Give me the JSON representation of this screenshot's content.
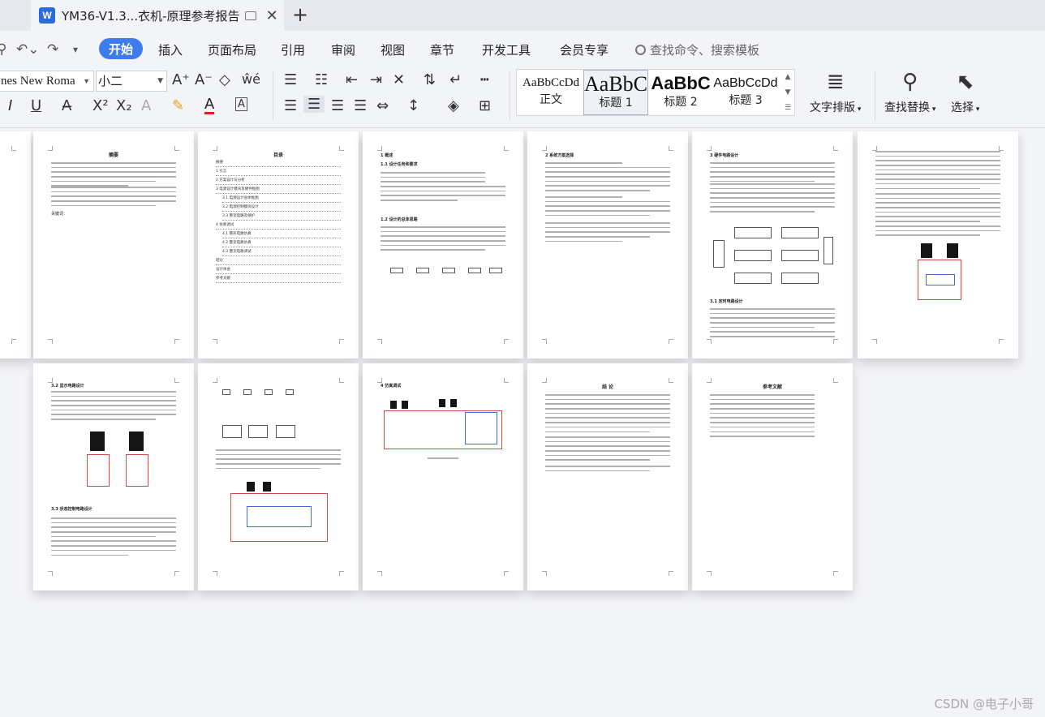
{
  "tab": {
    "icon_letter": "W",
    "title": "YM36-V1.3...衣机-原理参考报告",
    "new_tab": "+"
  },
  "menu": {
    "items": [
      "开始",
      "插入",
      "页面布局",
      "引用",
      "审阅",
      "视图",
      "章节",
      "开发工具",
      "会员专享"
    ],
    "search": "查找命令、搜索模板"
  },
  "ribbon": {
    "font_name": "nes New Roma",
    "font_size": "小二",
    "styles": [
      {
        "sample": "AaBbCcDd",
        "name": "正文"
      },
      {
        "sample": "AaBbC",
        "name": "标题 1"
      },
      {
        "sample": "AaBbC",
        "name": "标题 2"
      },
      {
        "sample": "AaBbCcDd",
        "name": "标题 3"
      }
    ],
    "text_layout": "文字排版",
    "find_replace": "查找替换",
    "select": "选择"
  },
  "pages": {
    "p1_title": "摘要",
    "p1_keywords": "关键词：",
    "p2_title": "目录",
    "toc": [
      "摘要",
      "1 引言",
      "2 方案设计与分析",
      "3 电源设计模块及硬件框图",
      "3.1 电源设计总体框图",
      "3.2 电源控制模块设计",
      "3.3 整流电路及保护",
      "4 仿真调试",
      "4.1 整形电路仿真",
      "4.2 整流电路仿真",
      "4.3 整流电路调试",
      "结论",
      "设计体会",
      "参考文献"
    ],
    "p3_h1": "1 概述",
    "p3_h2a": "1.1 设计任务和要求",
    "p3_h2b": "1.2 设计的总体思路",
    "p4_h1": "2 系统方案选择",
    "p5_h1": "3 硬件电路设计",
    "p5_h2": "3.1 定时电路设计",
    "p7_h2a": "3.2 显示电路设计",
    "p7_h2b": "3.3 状态控制电路设计",
    "p9_h1": "4 仿真调试",
    "p10_title": "结  论",
    "p11_title": "参考文献"
  },
  "watermark": "CSDN @电子小哥"
}
